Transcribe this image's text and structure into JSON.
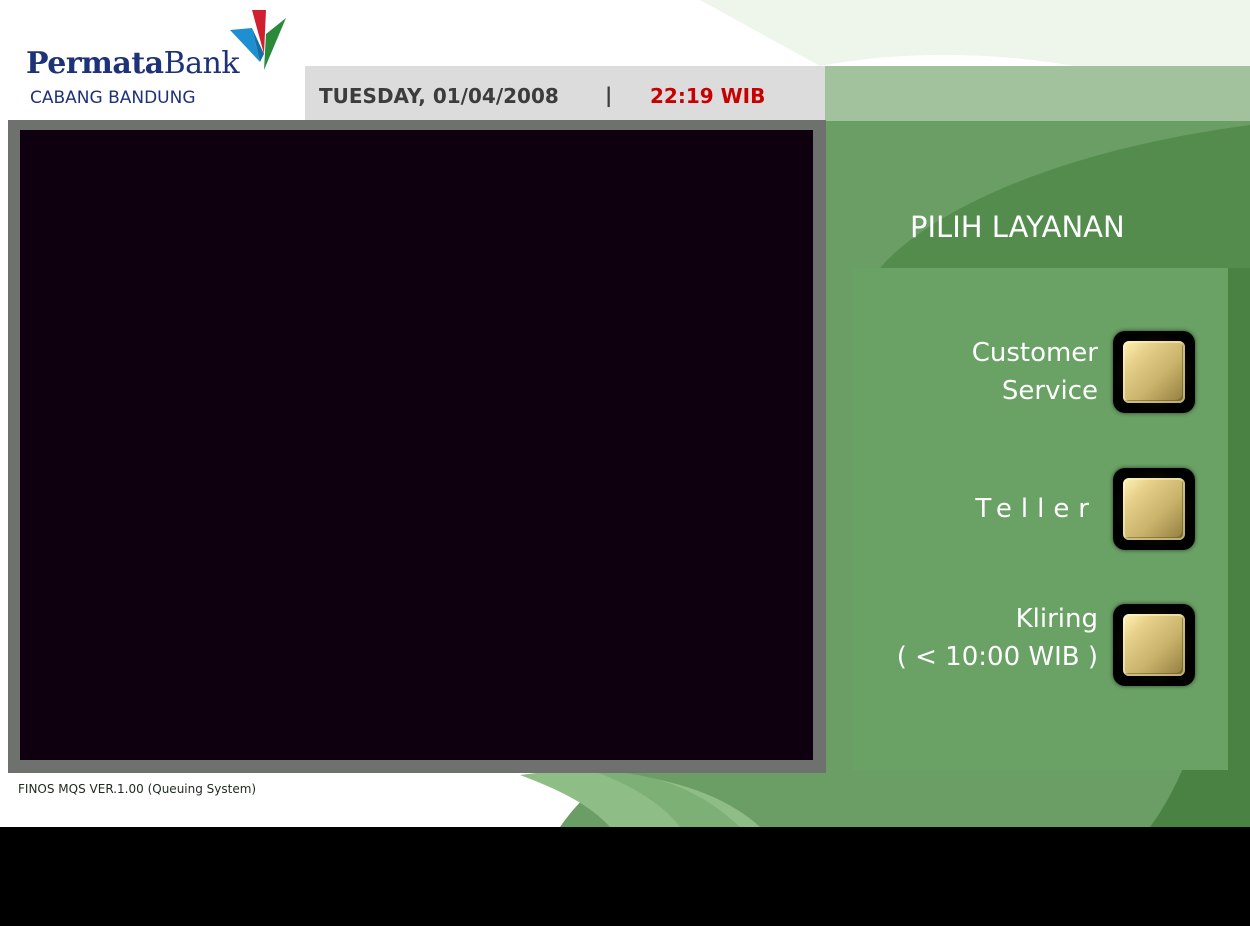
{
  "brand": {
    "name_bold": "Permata",
    "name_regular": "Bank",
    "branch": "CABANG BANDUNG"
  },
  "header": {
    "date": "TUESDAY, 01/04/2008",
    "separator": "|",
    "time": "22:19 WIB"
  },
  "services": {
    "title": "PILIH LAYANAN",
    "options": [
      {
        "line1": "Customer",
        "line2": "Service"
      },
      {
        "line1": "Teller",
        "line2": ""
      },
      {
        "line1": "Kliring",
        "line2": "( < 10:00 WIB )"
      }
    ]
  },
  "footer": {
    "version": "FINOS MQS VER.1.00 (Queuing System)"
  },
  "colors": {
    "brand_blue": "#1e3278",
    "time_red": "#c80000",
    "panel_green": "#6aa165",
    "display_black": "#0e000f"
  }
}
